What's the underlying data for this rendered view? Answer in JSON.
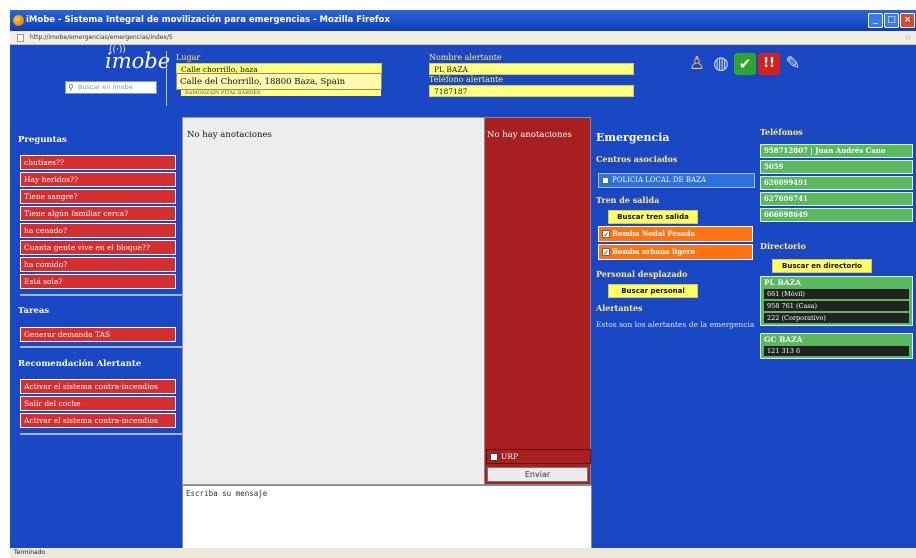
{
  "window": {
    "title": "iMobe - Sistema Integral de movilización para emergencias - Mozilla Firefox",
    "url": "http://imobe/emergencias/emergencias/index/5",
    "status": "Terminado"
  },
  "header": {
    "logo": "imobe",
    "search_placeholder": "Buscar en imobe",
    "lugar_label": "Lugar",
    "lugar_value": "Calle chorrillo, baza",
    "address_suggestion": "Calle del Chorrillo, 18800 Baza, Spain",
    "address_tail": "RAMONZAIN PITAL BARNES",
    "nombre_label": "Nombre alertante",
    "nombre_value": "PL BAZA",
    "telefono_label": "Teléfono alertante",
    "telefono_value": "7187187",
    "toolbar_icons": [
      "person-info-icon",
      "globe-icon",
      "check-icon",
      "alert-icon",
      "pen-icon"
    ]
  },
  "left": {
    "preguntas_title": "Preguntas",
    "preguntas": [
      "chutiaes??",
      "Hay heridos??",
      "Tiene sangre?",
      "Tiene algún familiar cerca?",
      "ha cenado?",
      "Cuanta gente vive en el bloque??",
      "ha comido?",
      "Está sola?"
    ],
    "tareas_title": "Tareas",
    "tareas": [
      "Generar demanda TAS"
    ],
    "recomendacion_title": "Recomendación Alertante",
    "recomendaciones": [
      "Activar el sistema contra-incendios",
      "Salir del coche",
      "Activar el sistema contra-incendios"
    ]
  },
  "center": {
    "notes_left": "No hay anotaciones",
    "notes_right": "No hay anotaciones",
    "urgent_label": "URP",
    "send_label": "Enviar",
    "message_placeholder": "Escriba su mensaje"
  },
  "emergency": {
    "title": "Emergencia",
    "centros_label": "Centros asociados",
    "centros": [
      "POLICIA LOCAL DE BAZA"
    ],
    "tren_label": "Tren de salida",
    "buscar_tren": "Buscar tren salida",
    "tren_items": [
      "Bomba Nodal Pesada",
      "Bomba urbana ligera"
    ],
    "personal_label": "Personal desplazado",
    "buscar_personal": "Buscar personal",
    "alertantes_label": "Alertantes",
    "alertantes_text": "Estos son los alertantes de la emergencia"
  },
  "right": {
    "telefonos_label": "Teléfonos",
    "telefonos": [
      "958712807 | Juan Andrés Cano",
      "5059",
      "620099491",
      "627606741",
      "606098649"
    ],
    "directorio_label": "Directorio",
    "buscar_directorio": "Buscar en directorio",
    "groups": [
      {
        "name": "PL BAZA",
        "entries": [
          "661 (Móvil)",
          "958 761 (Casa)",
          "222 (Corporativo)"
        ]
      },
      {
        "name": "GC BAZA",
        "entries": [
          "121 313 6"
        ]
      }
    ]
  }
}
